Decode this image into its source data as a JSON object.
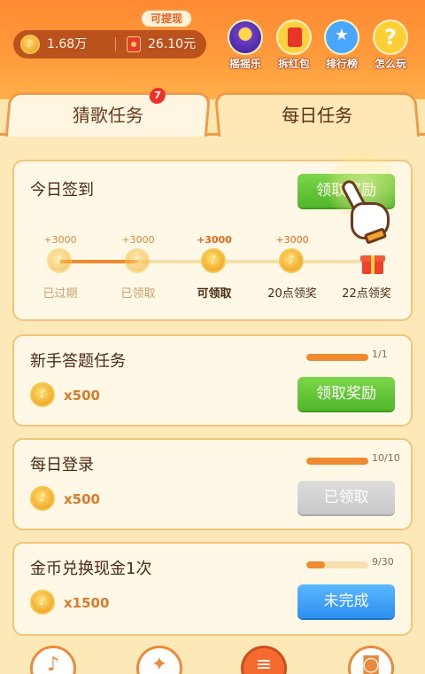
{
  "header": {
    "cash_tag": "可提现",
    "coins": "1.68万",
    "money": "26.10元",
    "buttons": [
      {
        "label": "摇摇乐",
        "icon": "disco-ball-icon"
      },
      {
        "label": "拆红包",
        "icon": "red-envelope-icon"
      },
      {
        "label": "排行榜",
        "icon": "trophy-icon"
      },
      {
        "label": "怎么玩",
        "icon": "question-icon"
      }
    ]
  },
  "tabs": {
    "guess_song": "猜歌任务",
    "guess_song_badge": "7",
    "daily": "每日任务"
  },
  "signin": {
    "title": "今日签到",
    "button": "领取奖励",
    "days": [
      {
        "points": "+3000",
        "label": "已过期",
        "state": "past"
      },
      {
        "points": "+3000",
        "label": "已领取",
        "state": "past"
      },
      {
        "points": "+3000",
        "label": "可领取",
        "state": "active"
      },
      {
        "points": "+3000",
        "label": "20点领奖",
        "state": "future"
      },
      {
        "points": "",
        "label": "22点领奖",
        "state": "gift"
      }
    ]
  },
  "tasks": [
    {
      "title": "新手答题任务",
      "reward": "x500",
      "progress_text": "1/1",
      "progress": 1.0,
      "button": "领取奖励",
      "button_state": "claim"
    },
    {
      "title": "每日登录",
      "reward": "x500",
      "progress_text": "10/10",
      "progress": 1.0,
      "button": "已领取",
      "button_state": "done"
    },
    {
      "title": "金币兑换现金1次",
      "reward": "x1500",
      "progress_text": "9/30",
      "progress": 0.3,
      "button": "未完成",
      "button_state": "incomplete"
    }
  ],
  "bottom_nav": [
    {
      "icon": "music-note-icon"
    },
    {
      "icon": "cat-icon"
    },
    {
      "icon": "task-list-icon"
    },
    {
      "icon": "bag-icon"
    }
  ],
  "colors": {
    "header_orange": "#ff8a33",
    "claim_green": "#4fb62a",
    "incomplete_blue": "#2e8fef",
    "progress_orange": "#f08a30"
  }
}
